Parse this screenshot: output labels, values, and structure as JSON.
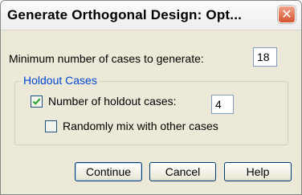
{
  "window": {
    "title": "Generate Orthogonal Design: Opt...",
    "close_glyph": "✕"
  },
  "min_cases": {
    "label": "Minimum number of cases to generate:",
    "value": "18"
  },
  "holdout": {
    "group_label": "Holdout Cases",
    "number_checkbox": {
      "label": "Number of holdout cases:",
      "checked": true
    },
    "number_value": "4",
    "mix_checkbox": {
      "label": "Randomly mix with other cases",
      "checked": false
    }
  },
  "buttons": {
    "continue": "Continue",
    "cancel": "Cancel",
    "help": "Help"
  },
  "icons": {
    "close": "close-icon",
    "check": "checkmark-icon"
  },
  "colors": {
    "dialog_bg": "#ece9d8",
    "group_label": "#0046d5",
    "close_button": "#d6532f",
    "checkmark": "#21a121"
  }
}
